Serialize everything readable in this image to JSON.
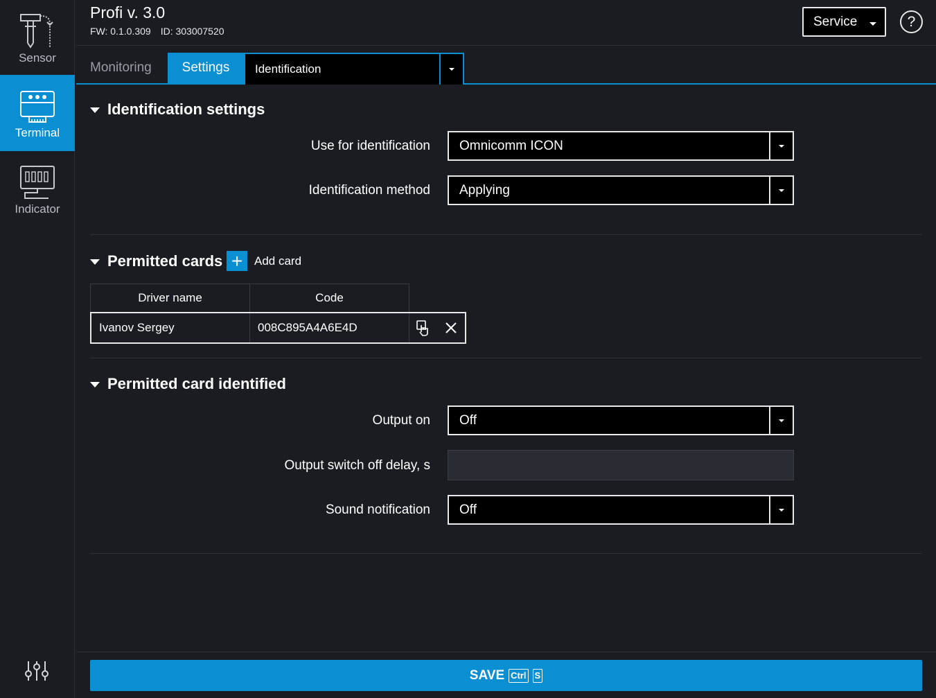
{
  "app": {
    "title": "Profi v. 3.0",
    "fw": "FW: 0.1.0.309",
    "id": "ID: 303007520"
  },
  "sidebar": {
    "items": [
      {
        "label": "Sensor",
        "icon": "sensor-icon"
      },
      {
        "label": "Terminal",
        "icon": "terminal-icon",
        "active": true
      },
      {
        "label": "Indicator",
        "icon": "indicator-icon"
      }
    ],
    "bottom_icon": "sliders-icon"
  },
  "header": {
    "service_label": "Service",
    "help_label": "?"
  },
  "tabs": {
    "monitoring": "Monitoring",
    "settings": "Settings",
    "section_selected": "Identification"
  },
  "identification": {
    "title": "Identification settings",
    "use_label": "Use for identification",
    "use_value": "Omnicomm ICON",
    "method_label": "Identification method",
    "method_value": "Applying"
  },
  "permitted": {
    "title": "Permitted cards",
    "add_card": "Add card",
    "add_icon": "+",
    "columns": [
      "Driver name",
      "Code"
    ],
    "rows": [
      {
        "name": "Ivanov Sergey",
        "code": "008C895A4A6E4D"
      }
    ]
  },
  "identified": {
    "title": "Permitted card identified",
    "output_label": "Output on",
    "output_value": "Off",
    "delay_label": "Output switch off delay, s",
    "delay_value": "",
    "sound_label": "Sound notification",
    "sound_value": "Off"
  },
  "save": {
    "label": "SAVE",
    "key1": "Ctrl",
    "key2": "S"
  },
  "colors": {
    "accent": "#0b8fd3",
    "background": "#1b1c22",
    "field": "#000000"
  }
}
